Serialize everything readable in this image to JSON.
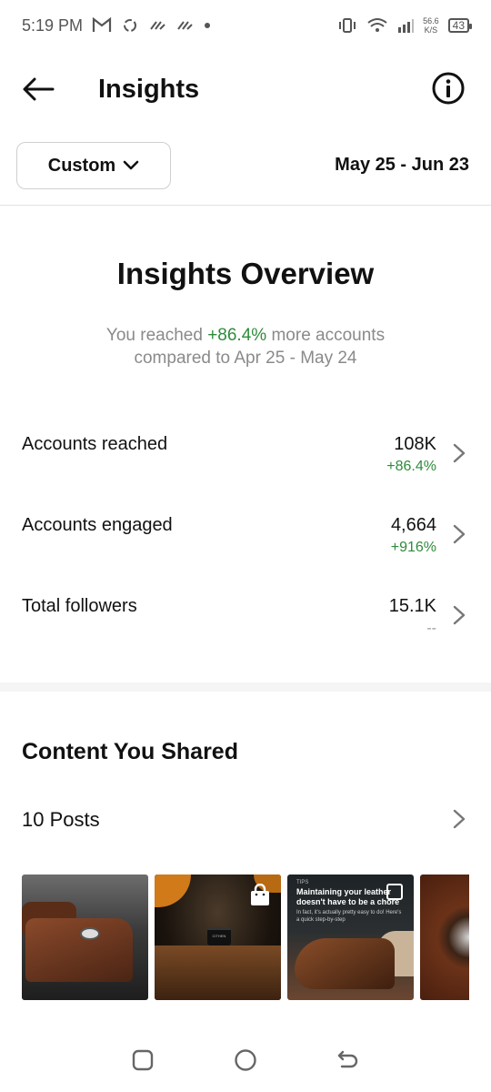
{
  "status_bar": {
    "time": "5:19 PM",
    "net_speed_value": "56.6",
    "net_speed_unit": "K/S",
    "battery": "43"
  },
  "header": {
    "title": "Insights",
    "back_icon": "arrow-left-icon",
    "info_icon": "info-icon"
  },
  "filter": {
    "custom_label": "Custom",
    "date_range": "May 25 - Jun 23"
  },
  "overview": {
    "title": "Insights Overview",
    "sub_prefix": "You reached ",
    "sub_pct": "+86.4%",
    "sub_suffix": " more accounts",
    "sub_line2": "compared to Apr 25 - May 24"
  },
  "metrics": [
    {
      "label": "Accounts reached",
      "value": "108K",
      "change": "+86.4%"
    },
    {
      "label": "Accounts engaged",
      "value": "4,664",
      "change": "+916%"
    },
    {
      "label": "Total followers",
      "value": "15.1K",
      "change": "--"
    }
  ],
  "content": {
    "title": "Content You Shared",
    "posts_label": "10 Posts",
    "thumb3": {
      "small": "TIPS",
      "headline": "Maintaining your leather doesn't have to be a chore",
      "body": "In fact, it's actually pretty easy to do! Here's a quick step-by-step"
    },
    "thumb2_label": "CITHEN"
  },
  "colors": {
    "positive": "#2e8b3a",
    "muted": "#8a8a8a"
  }
}
